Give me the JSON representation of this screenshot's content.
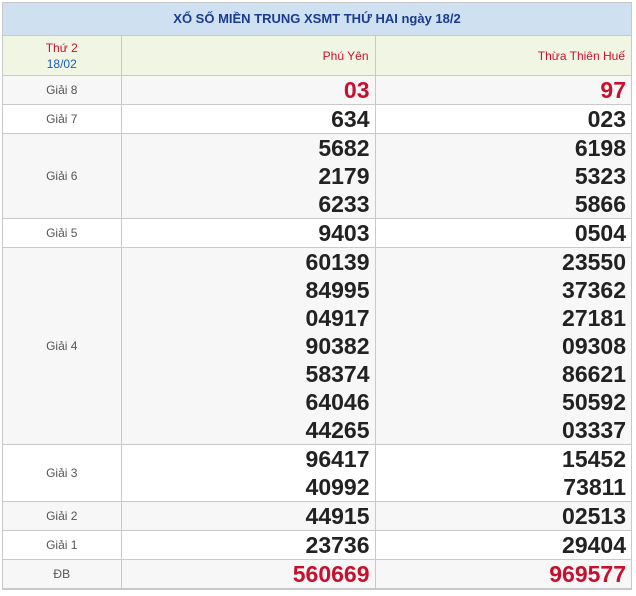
{
  "title": "XỔ SỐ MIỀN TRUNG XSMT THỨ HAI ngày 18/2",
  "header": {
    "day": "Thứ 2",
    "date": "18/02",
    "provinces": [
      "Phú Yên",
      "Thừa Thiên Huế"
    ]
  },
  "rows": [
    {
      "label": "Giải 8",
      "highlight": true,
      "values": [
        [
          "03"
        ],
        [
          "97"
        ]
      ]
    },
    {
      "label": "Giải 7",
      "values": [
        [
          "634"
        ],
        [
          "023"
        ]
      ]
    },
    {
      "label": "Giải 6",
      "values": [
        [
          "5682",
          "2179",
          "6233"
        ],
        [
          "6198",
          "5323",
          "5866"
        ]
      ]
    },
    {
      "label": "Giải 5",
      "values": [
        [
          "9403"
        ],
        [
          "0504"
        ]
      ]
    },
    {
      "label": "Giải 4",
      "values": [
        [
          "60139",
          "84995",
          "04917",
          "90382",
          "58374",
          "64046",
          "44265"
        ],
        [
          "23550",
          "37362",
          "27181",
          "09308",
          "86621",
          "50592",
          "03337"
        ]
      ]
    },
    {
      "label": "Giải 3",
      "values": [
        [
          "96417",
          "40992"
        ],
        [
          "15452",
          "73811"
        ]
      ]
    },
    {
      "label": "Giải 2",
      "values": [
        [
          "44915"
        ],
        [
          "02513"
        ]
      ]
    },
    {
      "label": "Giải 1",
      "values": [
        [
          "23736"
        ],
        [
          "29404"
        ]
      ]
    },
    {
      "label": "ĐB",
      "highlight": true,
      "values": [
        [
          "560669"
        ],
        [
          "969577"
        ]
      ]
    }
  ],
  "colors": {
    "title_bg": "#cfe0f1",
    "title_text": "#1a3b8f",
    "header_bg": "#f0f6e3",
    "highlight": "#c8102e",
    "number": "#222222"
  }
}
